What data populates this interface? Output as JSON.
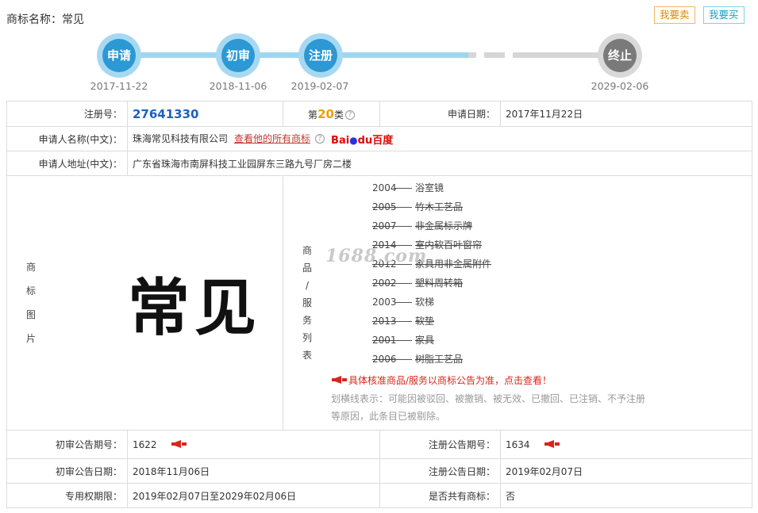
{
  "header": {
    "title": "商标名称：常见",
    "sell_label": "我要卖",
    "buy_label": "我要买"
  },
  "timeline": {
    "steps": [
      {
        "label": "申请",
        "date": "2017-11-22",
        "state": "done"
      },
      {
        "label": "初审",
        "date": "2018-11-06",
        "state": "done"
      },
      {
        "label": "注册",
        "date": "2019-02-07",
        "state": "done"
      },
      {
        "label": "终止",
        "date": "2029-02-06",
        "state": "future"
      }
    ]
  },
  "info": {
    "reg_no_label": "注册号：",
    "reg_no": "27641330",
    "class_prefix": "第",
    "class_num": "20",
    "class_suffix": "类",
    "apply_date_label": "申请日期：",
    "apply_date": "2017年11月22日",
    "applicant_label": "申请人名称(中文)：",
    "applicant": "珠海常见科技有限公司",
    "all_marks_link": "查看他的所有商标",
    "baidu_part1": "Bai",
    "baidu_part2": "du",
    "baidu_part3": "百度",
    "address_label": "申请人地址(中文)：",
    "address": "广东省珠海市南屏科技工业园屏东三路九号厂房二楼",
    "image_label": [
      "商",
      "标",
      "图",
      "片"
    ],
    "logo_text": "常见",
    "watermark": "1688.com",
    "goods_label": [
      "商",
      "品",
      "/",
      "服",
      "务",
      "列",
      "表"
    ],
    "goods": [
      {
        "code": "2004",
        "name": "浴室镜",
        "struck": false
      },
      {
        "code": "2005",
        "name": "竹木工艺品",
        "struck": true
      },
      {
        "code": "2007",
        "name": "非金属标示牌",
        "struck": true
      },
      {
        "code": "2014",
        "name": "室内软百叶窗帘",
        "struck": true
      },
      {
        "code": "2012",
        "name": "家具用非金属附件",
        "struck": true
      },
      {
        "code": "2002",
        "name": "塑料周转箱",
        "struck": true
      },
      {
        "code": "2003",
        "name": "软梯",
        "struck": false
      },
      {
        "code": "2013",
        "name": "软垫",
        "struck": true
      },
      {
        "code": "2001",
        "name": "家具",
        "struck": true
      },
      {
        "code": "2006",
        "name": "树脂工艺品",
        "struck": true
      }
    ],
    "goods_notice": "具体核准商品/服务以商标公告为准，点击查看！",
    "strike_note": "划横线表示：可能因被驳回、被撤销、被无效、已撤回、已注销、不予注册等原因，此条目已被剔除。",
    "prelim_no_label": "初审公告期号：",
    "prelim_no": "1622",
    "reg_pub_no_label": "注册公告期号：",
    "reg_pub_no": "1634",
    "prelim_date_label": "初审公告日期：",
    "prelim_date": "2018年11月06日",
    "reg_pub_date_label": "注册公告日期：",
    "reg_pub_date": "2019年02月07日",
    "exclusive_label": "专用权期限：",
    "exclusive_period": "2019年02月07日至2029年02月06日",
    "shared_label": "是否共有商标：",
    "shared_value": "否"
  },
  "colors": {
    "accent_blue": "#2c98d4",
    "future_gray": "#7a7a7a",
    "notice_red": "#d9261c",
    "class_orange": "#e6a100"
  }
}
